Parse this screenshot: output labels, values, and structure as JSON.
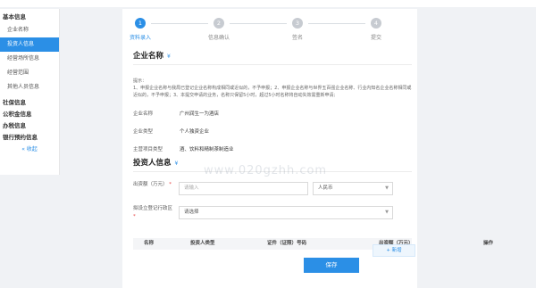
{
  "sidebar": {
    "groups": [
      {
        "label": "基本信息",
        "items": [
          "企业名称",
          "投资人信息",
          "经营场所信息",
          "经营范围",
          "其他人员信息"
        ]
      },
      {
        "label": "社保信息"
      },
      {
        "label": "公积金信息"
      },
      {
        "label": "办税信息"
      },
      {
        "label": "银行预约信息"
      }
    ],
    "active_item": "投资人信息",
    "collapse_label": "收起"
  },
  "steps": [
    {
      "num": "1",
      "label": "资料录入",
      "state": "active"
    },
    {
      "num": "2",
      "label": "信息确认",
      "state": "pending"
    },
    {
      "num": "3",
      "label": "签名",
      "state": "pending"
    },
    {
      "num": "4",
      "label": "提交",
      "state": "pending"
    }
  ],
  "company": {
    "title": "企业名称",
    "tips_heading": "提示：",
    "tips_body": "1、申报企业名称与我局已登记企业名称构成相同或近似的，不予申报；2、申报企业名称与世界五百强企业名称、行业内知名企业名称相同或近似的，不予申报；3、本提交申请的业务，名称只保留5小时，超过5小时名称将自动失效需重新申请;",
    "fields": [
      {
        "key": "企业名称",
        "value": "广州润生一为酒店"
      },
      {
        "key": "企业类型",
        "value": "个人独资企业"
      },
      {
        "key": "主营项目类型",
        "value": "酒、饮料和精制茶制造业"
      }
    ]
  },
  "investor": {
    "title": "投资人信息",
    "amount_label": "出资额（万元）",
    "amount_placeholder": "请输入",
    "currency": "人民币",
    "region_label": "拟设立登记行政区",
    "region_placeholder": "请选择",
    "table_headers": [
      "名称",
      "投资人类型",
      "证件（证照）号码",
      "出资额（万元）",
      "操作"
    ],
    "add_label": "+ 新增",
    "save_label": "保存"
  },
  "watermark": "www.020gzhh.com",
  "colors": {
    "accent": "#2b8fe6",
    "required": "#e63c3c"
  }
}
